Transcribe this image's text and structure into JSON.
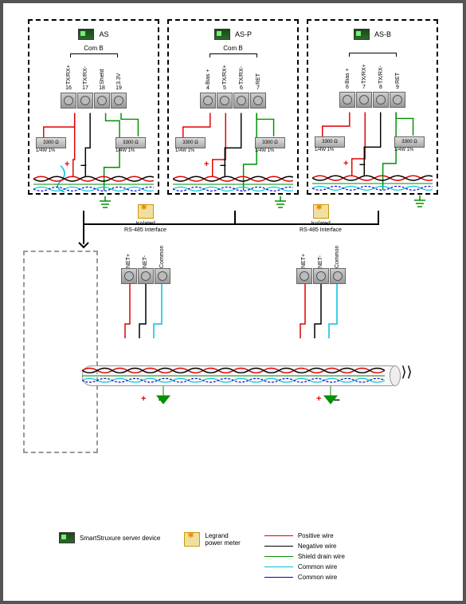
{
  "modules": [
    {
      "title": "AS",
      "com": "Com B",
      "pins": [
        {
          "label": "TX/RX+",
          "num": "16"
        },
        {
          "label": "TX/RX-",
          "num": "17"
        },
        {
          "label": "Shield",
          "num": "18"
        },
        {
          "label": "3.3V",
          "num": "19"
        }
      ],
      "resistors": [
        {
          "value": "3300 Ω",
          "spec": "1/4W 1%"
        },
        {
          "value": "3300 Ω",
          "spec": "1/4W 1%"
        }
      ]
    },
    {
      "title": "AS-P",
      "com": "Com B",
      "pins": [
        {
          "label": "Bias +",
          "num": "4"
        },
        {
          "label": "TX/RX+",
          "num": "5"
        },
        {
          "label": "TX/RX-",
          "num": "6"
        },
        {
          "label": "RET",
          "num": "7"
        }
      ],
      "resistors": [
        {
          "value": "3300 Ω",
          "spec": "1/4W 1%"
        },
        {
          "value": "3300 Ω",
          "spec": "1/4W 1%"
        }
      ]
    },
    {
      "title": "AS-B",
      "com": "",
      "pins": [
        {
          "label": "Bias +",
          "num": "6"
        },
        {
          "label": "TX/RX+",
          "num": "7"
        },
        {
          "label": "TX/RX-",
          "num": "8"
        },
        {
          "label": "RET",
          "num": "9"
        }
      ],
      "resistors": [
        {
          "value": "3300 Ω",
          "spec": "1/4W 1%"
        },
        {
          "value": "3300 Ω",
          "spec": "1/4W 1%"
        }
      ]
    }
  ],
  "interfaces": [
    {
      "title": "Isolated\nRS-485 Interface",
      "pins": [
        {
          "label": "NET+"
        },
        {
          "label": "NET-"
        },
        {
          "label": "Common"
        }
      ]
    },
    {
      "title": "Isolated\nRS-485 Interface",
      "pins": [
        {
          "label": "NET+"
        },
        {
          "label": "NET-"
        },
        {
          "label": "Common"
        }
      ]
    }
  ],
  "legend": {
    "server": "SmartStruxure server device",
    "meter": "Legrand\npower meter",
    "wires": [
      {
        "name": "Positive wire",
        "color": "#e00000"
      },
      {
        "name": "Negative wire",
        "color": "#000000"
      },
      {
        "name": "Shield drain wire",
        "color": "#009000"
      },
      {
        "name": "Common wire",
        "color": "#00c0e0"
      },
      {
        "name": "Common wire",
        "color": "#0000cc"
      }
    ]
  },
  "symbols": {
    "plus": "+",
    "minus": "–"
  }
}
